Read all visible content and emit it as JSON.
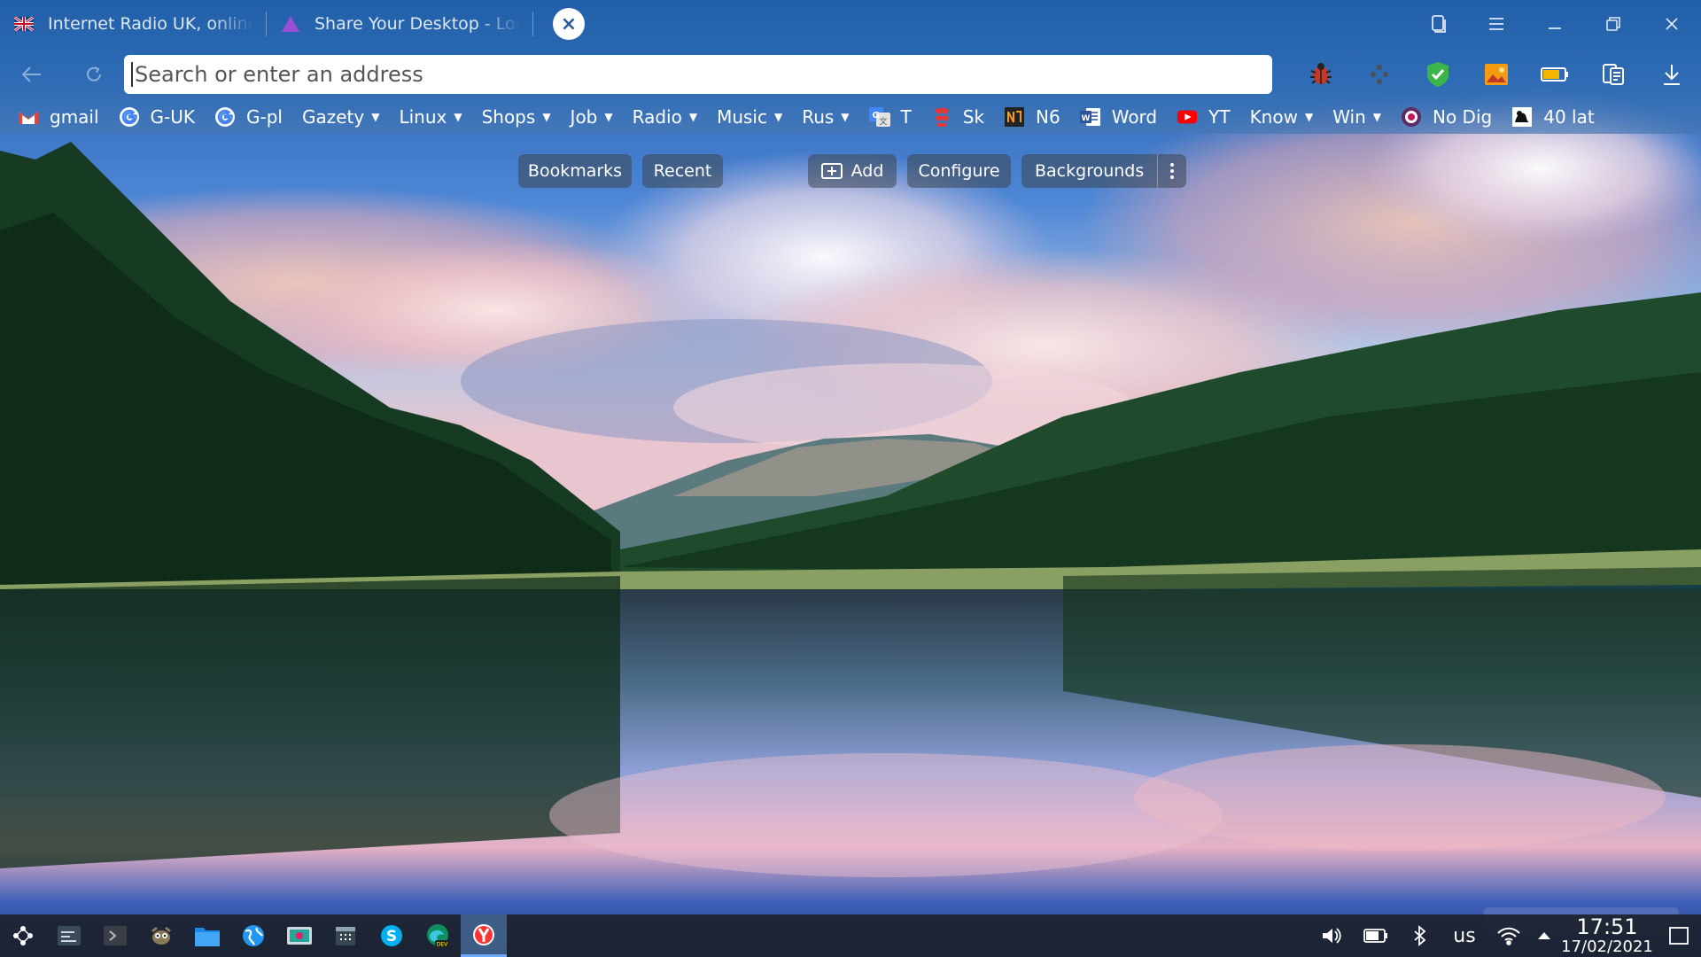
{
  "tabs": [
    {
      "title": "Internet Radio UK, online",
      "favicon": "uk-flag-icon"
    },
    {
      "title": "Share Your Desktop - Lou",
      "favicon": "purple-triangle-icon"
    }
  ],
  "tab_close_symbol": "×",
  "address_bar": {
    "placeholder": "Search or enter an address",
    "value": ""
  },
  "bookmarks": [
    {
      "label": "gmail",
      "icon": "gmail-icon",
      "menu": false
    },
    {
      "label": "G-UK",
      "icon": "google-icon",
      "menu": false
    },
    {
      "label": "G-pl",
      "icon": "google-icon",
      "menu": false
    },
    {
      "label": "Gazety",
      "icon": "",
      "menu": true
    },
    {
      "label": "Linux",
      "icon": "",
      "menu": true
    },
    {
      "label": "Shops",
      "icon": "",
      "menu": true
    },
    {
      "label": "Job",
      "icon": "",
      "menu": true
    },
    {
      "label": "Radio",
      "icon": "",
      "menu": true
    },
    {
      "label": "Music",
      "icon": "",
      "menu": true
    },
    {
      "label": "Rus",
      "icon": "",
      "menu": true
    },
    {
      "label": "T",
      "icon": "translate-icon",
      "menu": false
    },
    {
      "label": "Sk",
      "icon": "sk-icon",
      "menu": false
    },
    {
      "label": "N6",
      "icon": "n6-icon",
      "menu": false
    },
    {
      "label": "Word",
      "icon": "word-icon",
      "menu": false
    },
    {
      "label": "YT",
      "icon": "youtube-icon",
      "menu": false
    },
    {
      "label": "Know",
      "icon": "",
      "menu": true
    },
    {
      "label": "Win",
      "icon": "",
      "menu": true
    },
    {
      "label": "No Dig",
      "icon": "no-dig-icon",
      "menu": false
    },
    {
      "label": "40 lat",
      "icon": "forty-lat-icon",
      "menu": false
    }
  ],
  "content_buttons": {
    "bookmarks": "Bookmarks",
    "recent": "Recent",
    "add": "Add",
    "configure": "Configure",
    "backgrounds": "Backgrounds"
  },
  "taskbar": {
    "keyboard_layout": "us",
    "time": "17:51",
    "date": "17/02/2021"
  },
  "colors": {
    "chrome": "#2b66ad",
    "taskbar": "#1c222c",
    "active_app": "#6fa8ff"
  }
}
